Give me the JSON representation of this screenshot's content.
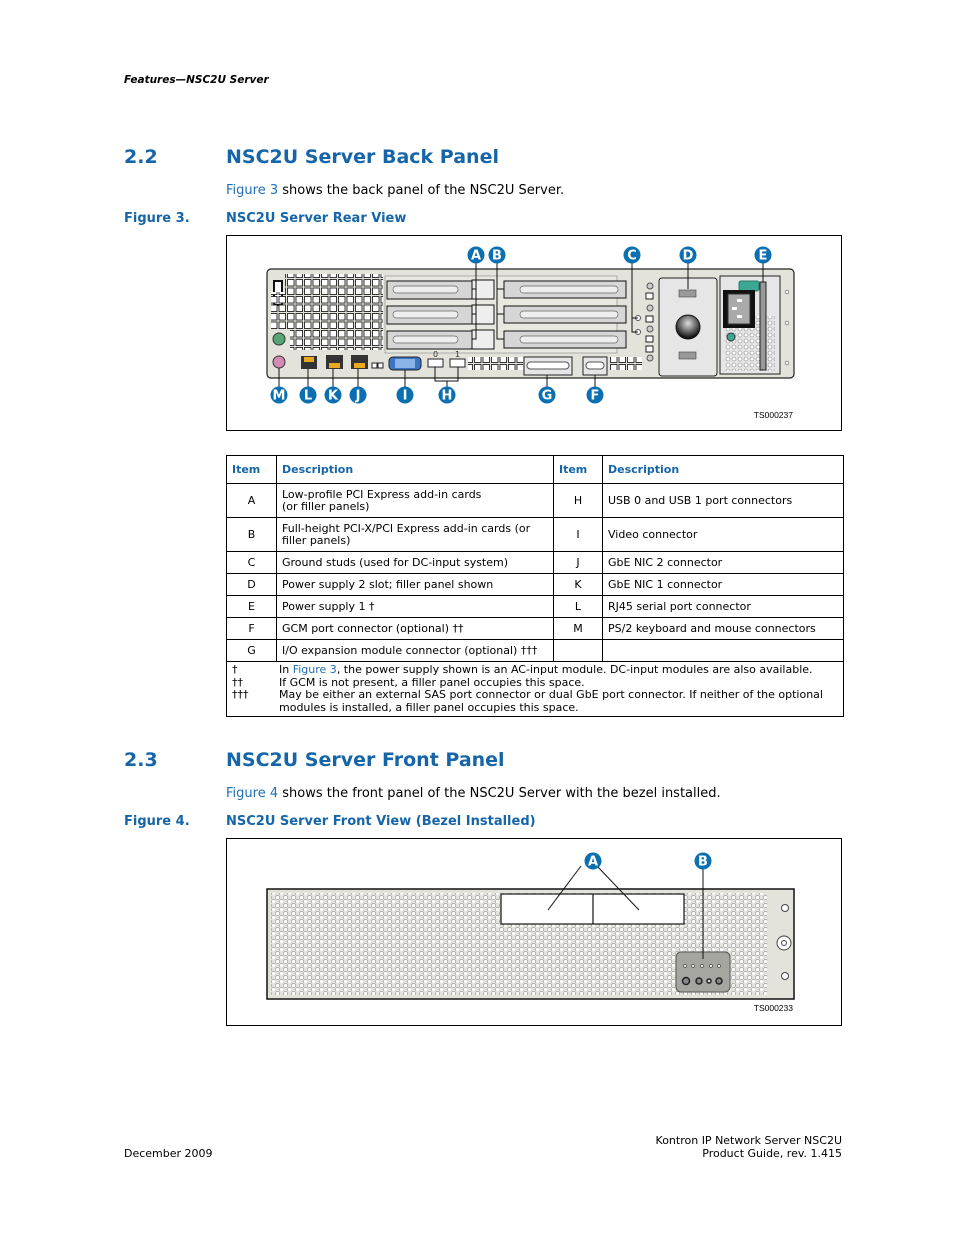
{
  "running_head": "Features—NSC2U Server",
  "section_2_2": {
    "number": "2.2",
    "title": "NSC2U Server Back Panel",
    "intro_link": "Figure 3",
    "intro_rest": " shows the back panel of the NSC2U Server."
  },
  "figure3": {
    "label": "Figure 3.",
    "title": "NSC2U Server Rear View",
    "ts_code": "TS000237",
    "callouts_top": [
      "A",
      "B",
      "C",
      "D",
      "E"
    ],
    "callouts_bottom": [
      "M",
      "L",
      "K",
      "J",
      "I",
      "H",
      "G",
      "F"
    ],
    "usb_labels": [
      "0",
      "1"
    ]
  },
  "legend_table": {
    "headers": [
      "Item",
      "Description",
      "Item",
      "Description"
    ],
    "rows": [
      {
        "item1": "A",
        "desc1_l1": "Low-profile PCI Express add-in cards",
        "desc1_l2": "(or filler panels)",
        "item2": "H",
        "desc2": "USB 0 and USB 1 port connectors"
      },
      {
        "item1": "B",
        "desc1_l1": "Full-height PCI-X/PCI Express add-in cards (or",
        "desc1_l2": "filler panels)",
        "item2": "I",
        "desc2": "Video connector"
      },
      {
        "item1": "C",
        "desc1_l1": "Ground studs (used for DC-input system)",
        "desc1_l2": "",
        "item2": "J",
        "desc2": "GbE NIC 2 connector"
      },
      {
        "item1": "D",
        "desc1_l1": "Power supply 2 slot; filler panel shown",
        "desc1_l2": "",
        "item2": "K",
        "desc2": "GbE NIC 1 connector"
      },
      {
        "item1": "E",
        "desc1_l1": "Power supply 1 †",
        "desc1_l2": "",
        "item2": "L",
        "desc2": "RJ45 serial port connector"
      },
      {
        "item1": "F",
        "desc1_l1": "GCM port connector (optional) ††",
        "desc1_l2": "",
        "item2": "M",
        "desc2": "PS/2 keyboard and mouse connectors"
      },
      {
        "item1": "G",
        "desc1_l1": "I/O expansion module connector (optional) †††",
        "desc1_l2": "",
        "item2": "",
        "desc2": ""
      }
    ],
    "footnotes": [
      {
        "mark": "†",
        "pre": "In ",
        "link": "Figure 3",
        "text": ", the power supply shown is an AC-input module. DC-input modules are also available."
      },
      {
        "mark": "††",
        "pre": "",
        "link": "",
        "text": "If GCM is not present, a filler panel occupies this space."
      },
      {
        "mark": "†††",
        "pre": "",
        "link": "",
        "text": "May be either an external SAS port connector or dual GbE port connector. If neither of the optional"
      },
      {
        "mark": "",
        "pre": "",
        "link": "",
        "text": "modules is installed, a filler panel occupies this space."
      }
    ]
  },
  "section_2_3": {
    "number": "2.3",
    "title": "NSC2U Server Front Panel",
    "intro_link": "Figure 4",
    "intro_rest": " shows the front panel of the NSC2U Server with the bezel installed."
  },
  "figure4": {
    "label": "Figure 4.",
    "title": "NSC2U Server Front View (Bezel Installed)",
    "ts_code": "TS000233",
    "callouts": [
      "A",
      "B"
    ]
  },
  "footer": {
    "date": "December 2009",
    "product": "Kontron IP Network Server NSC2U",
    "guide": "Product Guide, rev. 1.415"
  },
  "colors": {
    "heading_blue": "#1565a8",
    "link_blue": "#1f6fb5",
    "callout_blue": "#0b6fb0",
    "chassis_gray": "#e3e3db"
  }
}
